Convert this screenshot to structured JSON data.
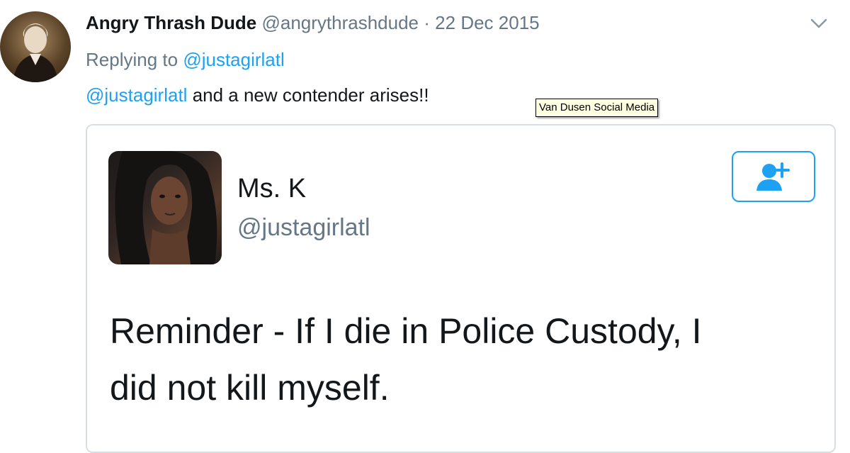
{
  "tweet": {
    "author_name": "Angry Thrash Dude",
    "author_handle": "@angrythrashdude",
    "separator": "·",
    "date": "22 Dec 2015",
    "reply_prefix": "Replying to",
    "reply_to": "@justagirlatl",
    "text_mention": "@justagirlatl",
    "text_body": "and a new contender arises!!",
    "avatar_icon": "portrait-avatar-icon",
    "menu_icon": "chevron-down-icon"
  },
  "tooltip": {
    "text": "Van Dusen Social Media"
  },
  "quoted": {
    "name": "Ms. K",
    "handle": "@justagirlatl",
    "text_line1": "Reminder - If I die in Police Custody,  I",
    "text_line2": "did not kill myself.",
    "follow_icon": "add-user-icon"
  },
  "colors": {
    "link": "#1da1f2",
    "muted": "#657786",
    "text": "#14171a",
    "border": "#d8dde2"
  }
}
